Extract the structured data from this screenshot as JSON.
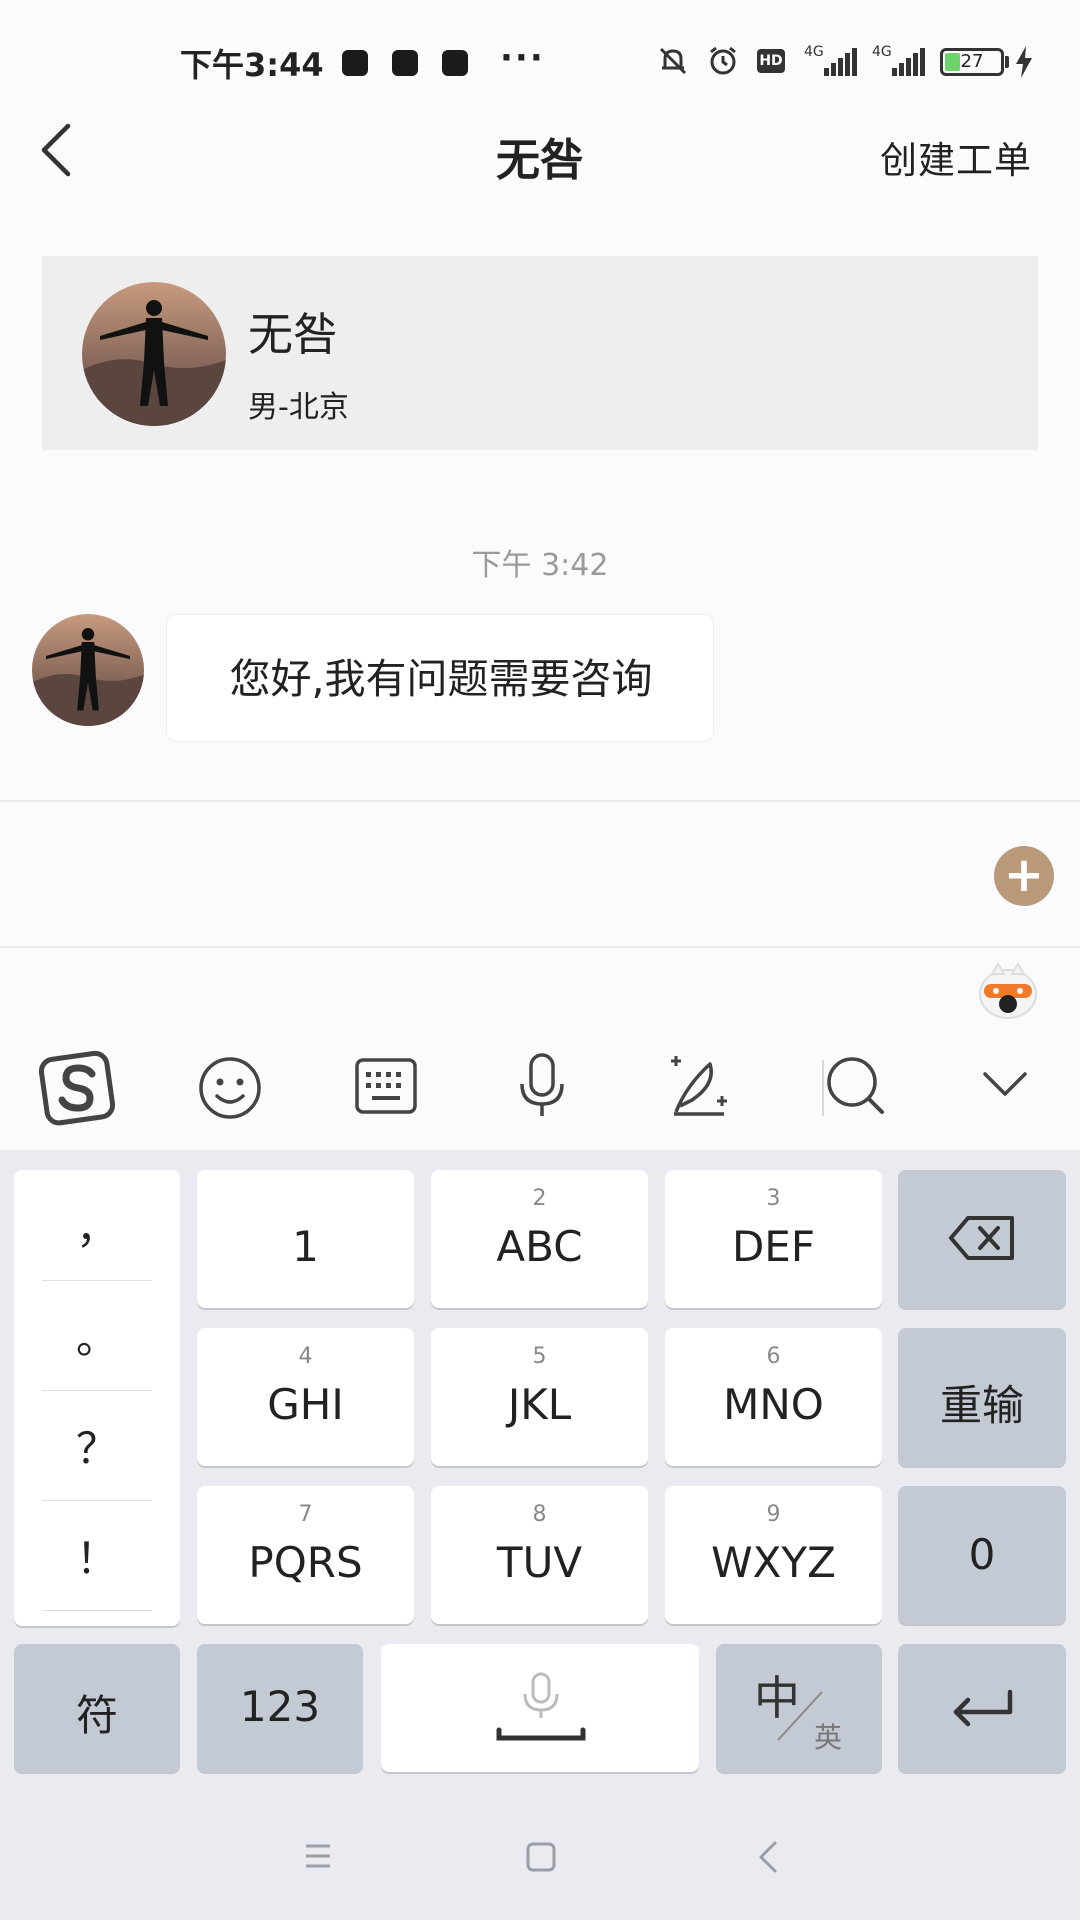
{
  "status_bar": {
    "time": "下午3:44",
    "more": "···",
    "hd": "HD",
    "network_1": "4G",
    "network_2": "4G",
    "battery": "27",
    "battery_level": 0.27
  },
  "header": {
    "title": "无咎",
    "action": "创建工单"
  },
  "profile": {
    "name": "无咎",
    "meta": "男-北京"
  },
  "chat": {
    "timestamp": "下午 3:42",
    "messages": [
      {
        "text": "您好,我有问题需要咨询"
      }
    ]
  },
  "input": {
    "add_label": "+"
  },
  "keyboard": {
    "toolbar": [
      "sogou-logo-icon",
      "emoji-icon",
      "keyboard-icon",
      "microphone-icon",
      "handwriting-icon",
      "search-icon",
      "collapse-icon"
    ],
    "punctuation": [
      "，",
      "。",
      "？",
      "！"
    ],
    "keys": [
      {
        "num": "",
        "label": "1"
      },
      {
        "num": "2",
        "label": "ABC"
      },
      {
        "num": "3",
        "label": "DEF"
      },
      {
        "num": "4",
        "label": "GHI"
      },
      {
        "num": "5",
        "label": "JKL"
      },
      {
        "num": "6",
        "label": "MNO"
      },
      {
        "num": "7",
        "label": "PQRS"
      },
      {
        "num": "8",
        "label": "TUV"
      },
      {
        "num": "9",
        "label": "WXYZ"
      }
    ],
    "reenter": "重输",
    "zero": "0",
    "symbols": "符",
    "numbers": "123",
    "lang_zh": "中",
    "lang_en": "英"
  },
  "colors": {
    "accent": "#b89a7b",
    "keyboard_bg": "#e9ebf1",
    "dark_key": "#c4cad4"
  }
}
